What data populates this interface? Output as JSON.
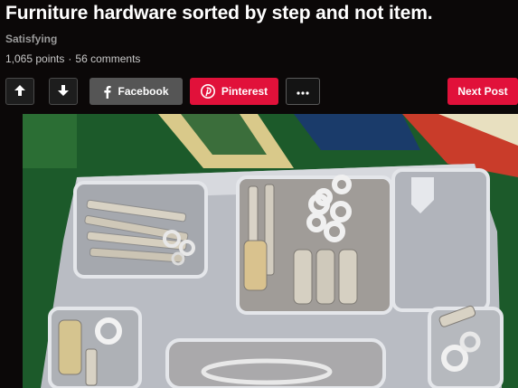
{
  "post": {
    "title": "Furniture hardware sorted by step and not item.",
    "section": "Satisfying",
    "points": "1,065 points",
    "separator": "·",
    "comments": "56 comments"
  },
  "toolbar": {
    "upvote_icon": "arrow-up-icon",
    "downvote_icon": "arrow-down-icon",
    "facebook_label": "Facebook",
    "facebook_icon": "facebook-icon",
    "pinterest_label": "Pinterest",
    "pinterest_icon": "pinterest-icon",
    "more_icon": "more-dots-icon",
    "next_label": "Next Post"
  },
  "image": {
    "subject": "plastic tray with compartments of screws, bolts, washers and hardware"
  },
  "colors": {
    "background": "#0b0808",
    "accent_red": "#e1113a",
    "facebook_grey": "#555555"
  }
}
